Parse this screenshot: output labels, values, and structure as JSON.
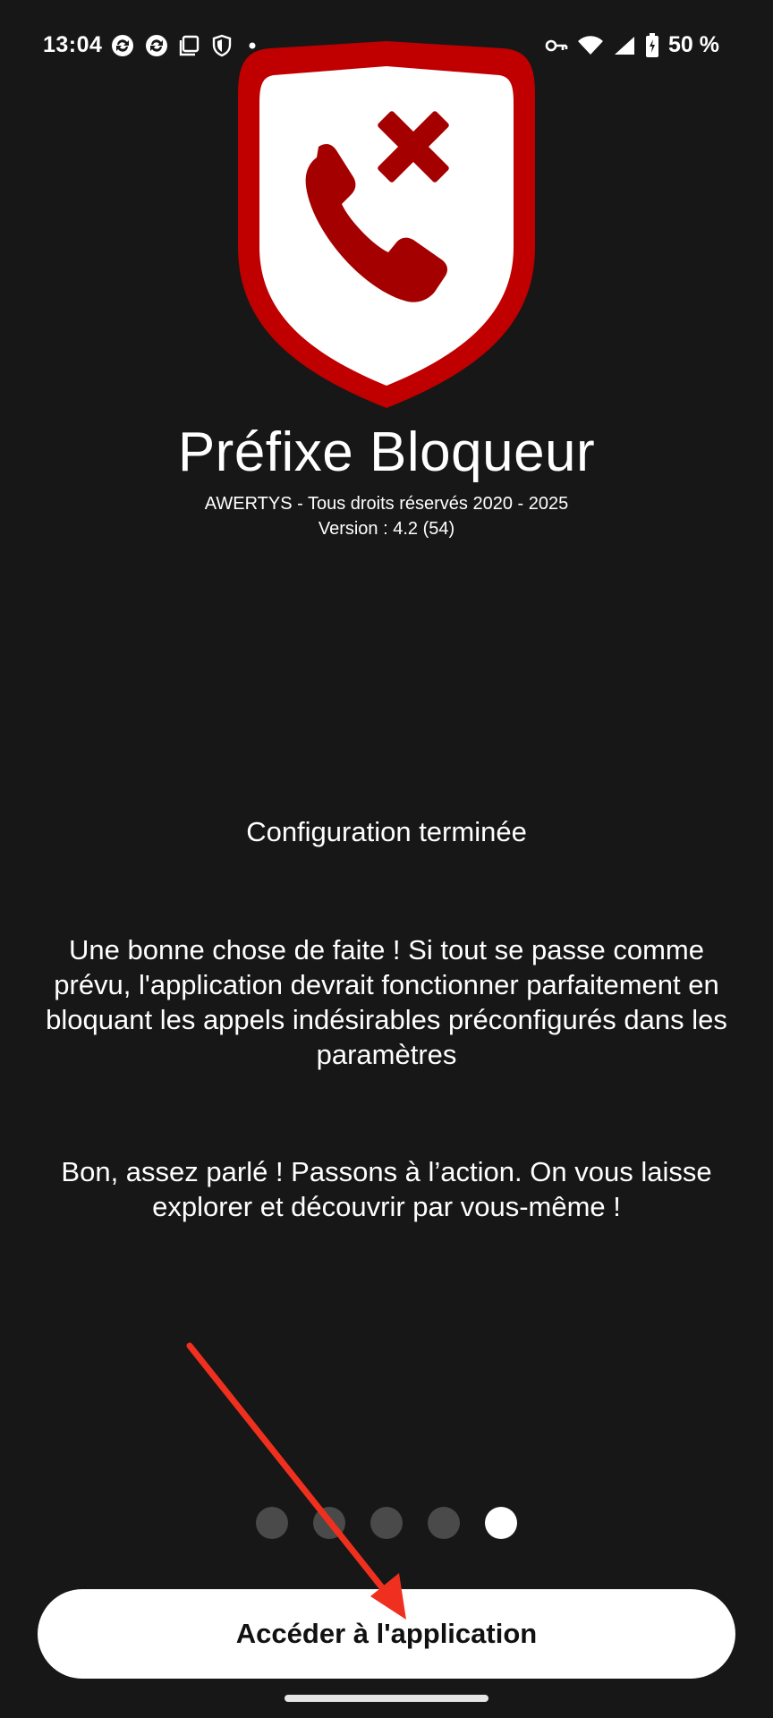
{
  "status_bar": {
    "time": "13:04",
    "battery_percent": "50 %",
    "left_icons": [
      "sync-icon",
      "sync-icon",
      "screen-icon",
      "shield-icon",
      "dot-icon"
    ],
    "right_icons": [
      "vpn-key-icon",
      "wifi-icon",
      "signal-icon",
      "battery-charging-icon"
    ]
  },
  "app": {
    "title": "Préfixe Bloqueur",
    "copyright": "AWERTYS - Tous droits réservés 2020 - 2025",
    "version": "Version : 4.2 (54)",
    "logo_icon": "call-block-shield-icon",
    "logo_colors": {
      "shield": "#c00000",
      "inner": "#ffffff",
      "phone": "#a50000"
    }
  },
  "onboarding": {
    "section_title": "Configuration terminée",
    "paragraph_1": "Une bonne chose de faite ! Si tout se passe comme prévu, l'application devrait fonctionner parfaitement en bloquant les appels indésirables préconfigurés dans les paramètres",
    "paragraph_2": "Bon, assez parlé ! Passons à l’action. On vous laisse explorer et découvrir par vous-même !",
    "page_count": 5,
    "current_page": 5
  },
  "actions": {
    "primary_button_label": "Accéder à l'application"
  },
  "annotation": {
    "arrow_color": "#f0301e"
  }
}
